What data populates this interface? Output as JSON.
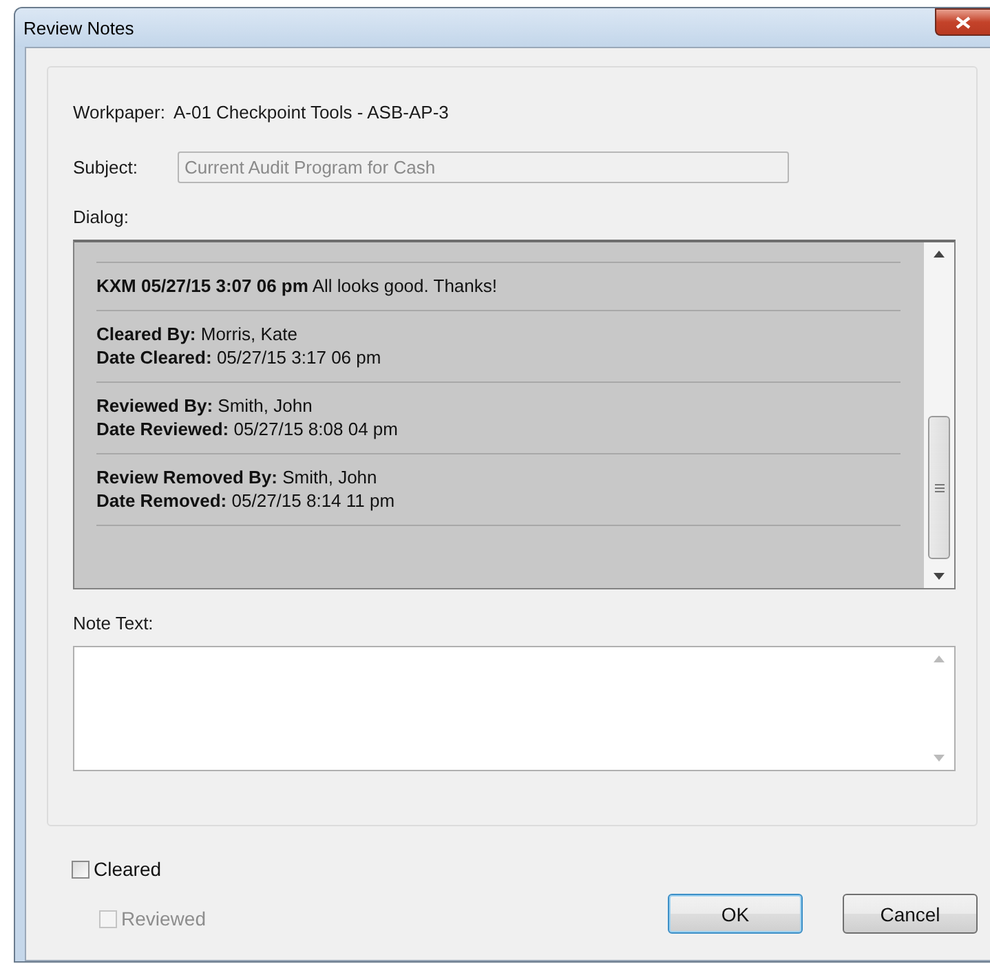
{
  "window": {
    "title": "Review Notes"
  },
  "workpaper": {
    "label": "Workpaper:",
    "value": "A-01  Checkpoint Tools - ASB-AP-3"
  },
  "subject": {
    "label": "Subject:",
    "value": "Current Audit Program for Cash",
    "disabled": true
  },
  "dialog": {
    "label": "Dialog:",
    "entries": [
      {
        "lines": [
          {
            "label": "KXM 05/27/15 3:07 06 pm",
            "value": "All looks good. Thanks!"
          }
        ]
      },
      {
        "lines": [
          {
            "label": "Cleared By:",
            "value": "Morris, Kate"
          },
          {
            "label": "Date Cleared:",
            "value": "05/27/15 3:17 06 pm"
          }
        ]
      },
      {
        "lines": [
          {
            "label": "Reviewed By:",
            "value": "Smith, John"
          },
          {
            "label": "Date Reviewed:",
            "value": "05/27/15 8:08 04 pm"
          }
        ]
      },
      {
        "lines": [
          {
            "label": "Review Removed By:",
            "value": "Smith, John"
          },
          {
            "label": "Date Removed:",
            "value": "05/27/15 8:14 11 pm"
          }
        ]
      }
    ]
  },
  "note_text": {
    "label": "Note Text:"
  },
  "checkboxes": [
    {
      "label": "Cleared",
      "checked": false,
      "disabled": false
    },
    {
      "label": "Reviewed",
      "checked": false,
      "disabled": true
    }
  ],
  "buttons": [
    {
      "label": "OK",
      "default": true
    },
    {
      "label": "Cancel",
      "default": false
    }
  ]
}
